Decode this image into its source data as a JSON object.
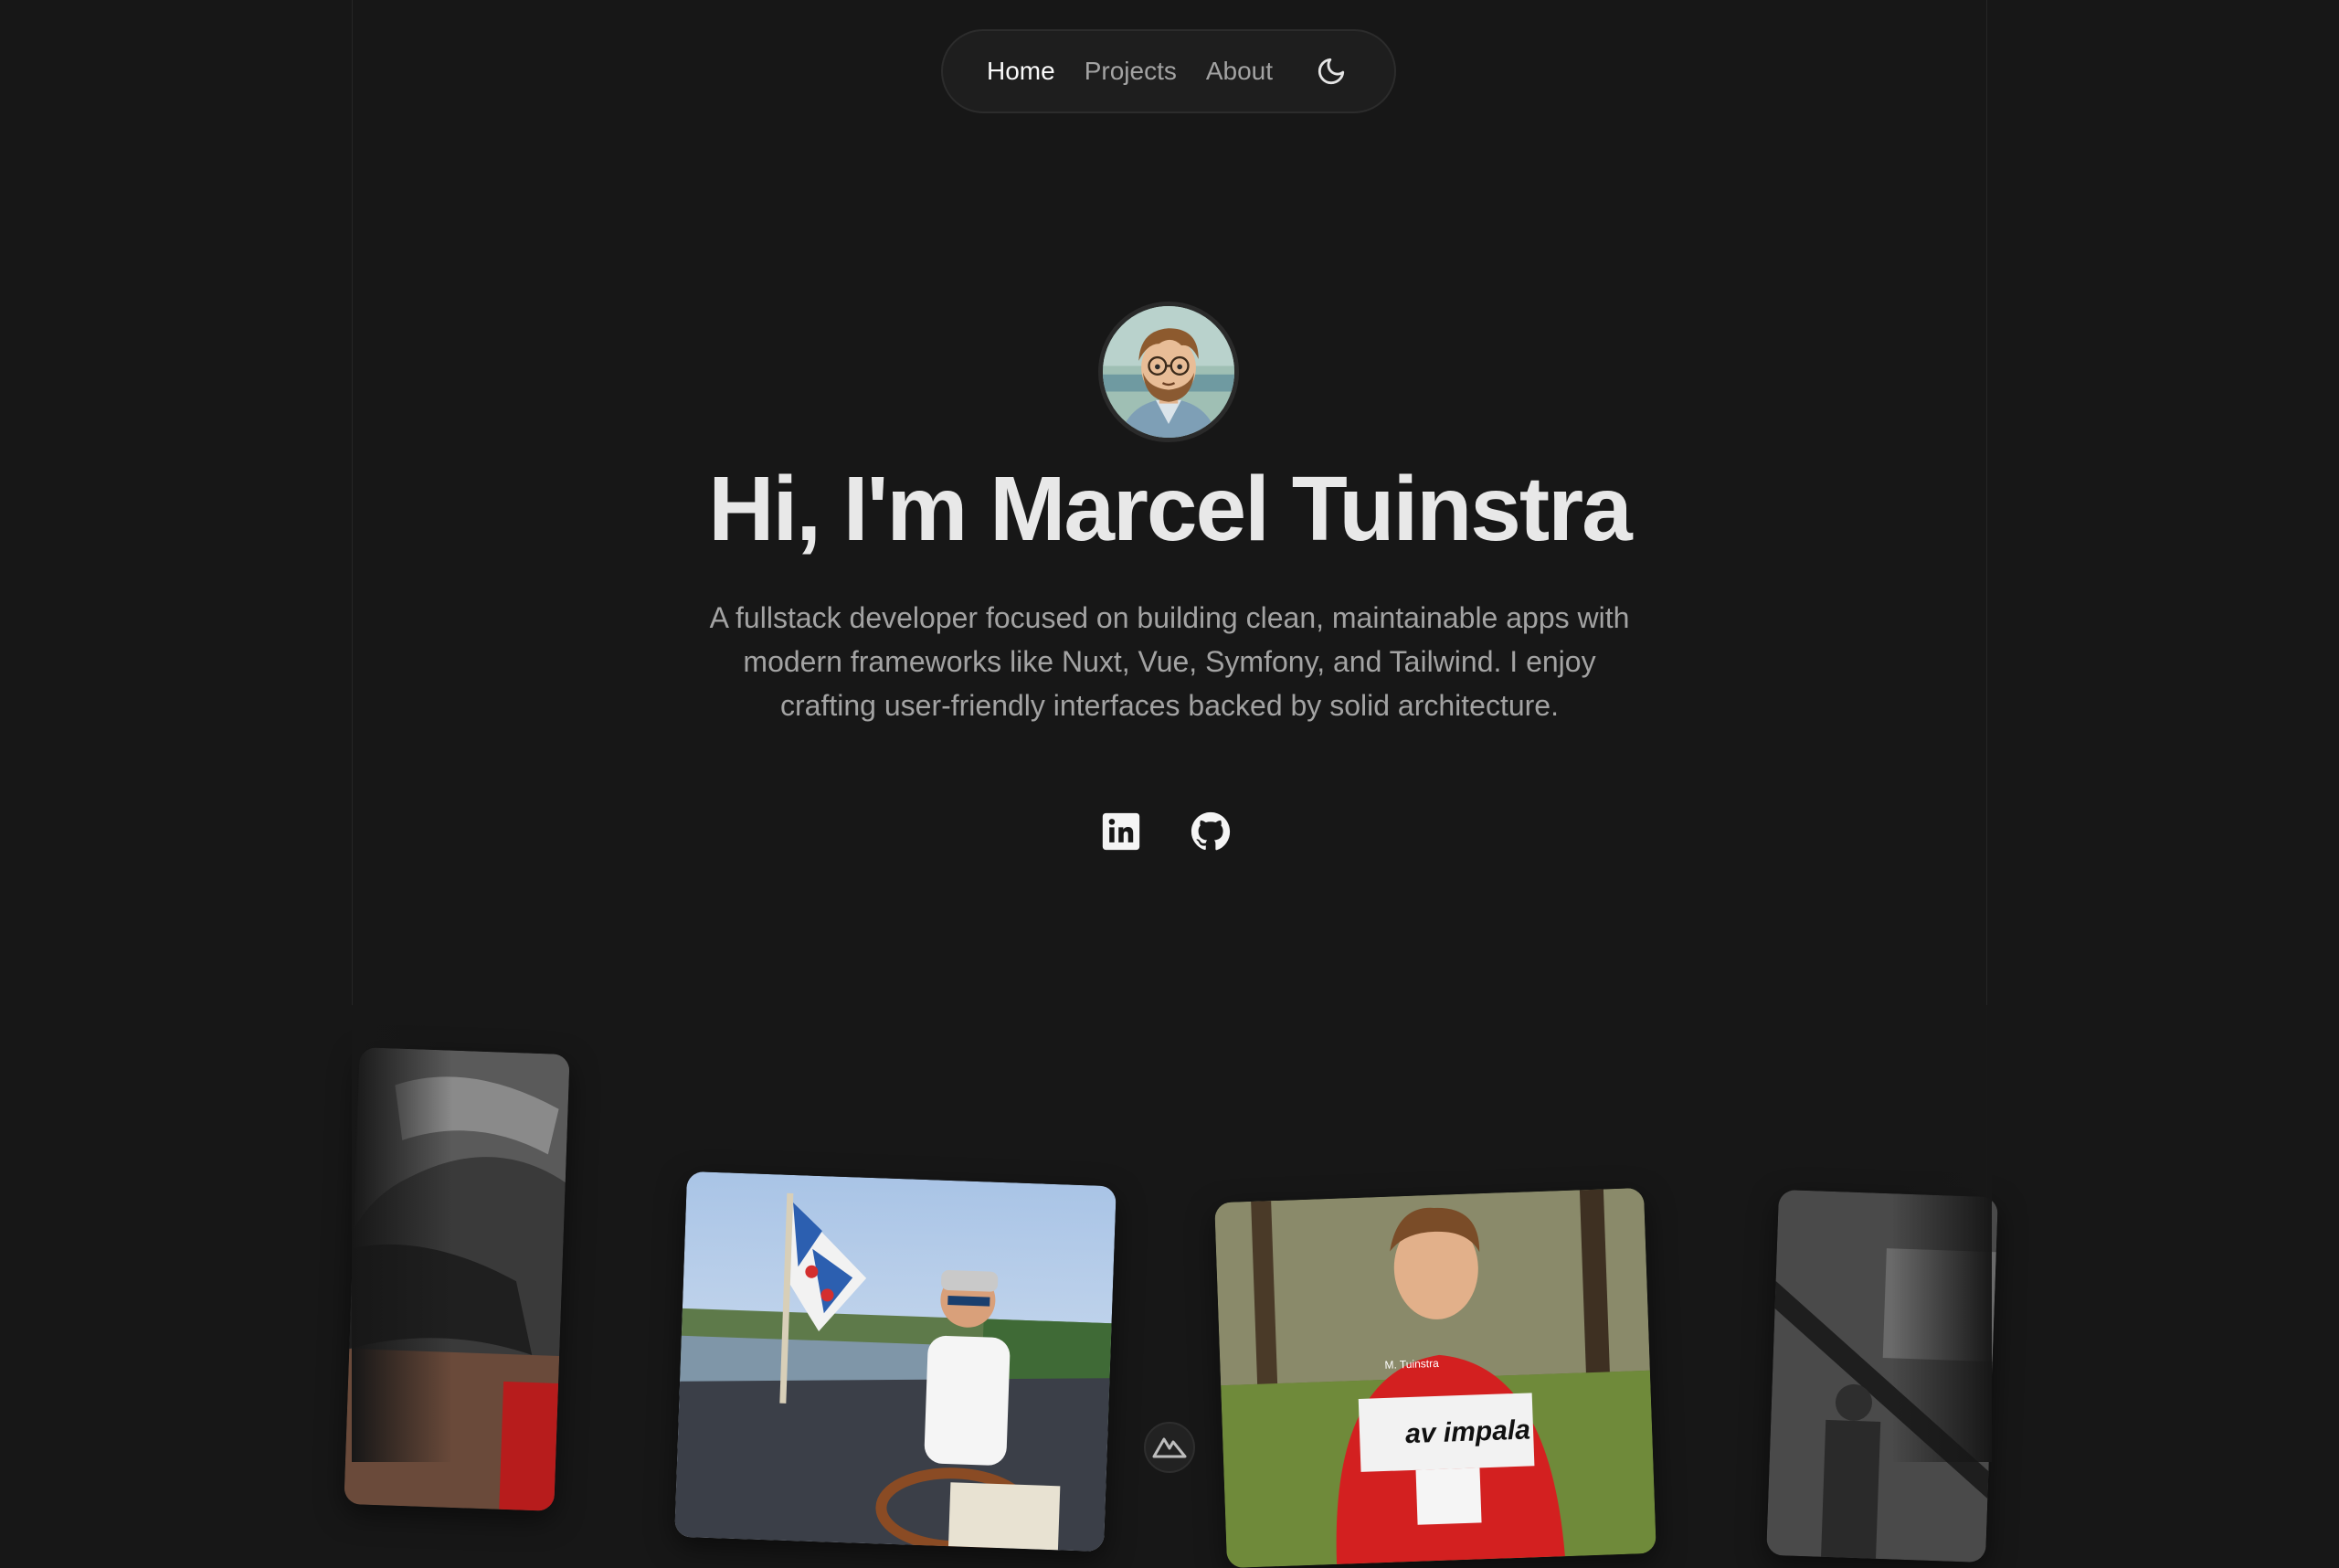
{
  "nav": {
    "items": [
      {
        "label": "Home",
        "active": true
      },
      {
        "label": "Projects",
        "active": false
      },
      {
        "label": "About",
        "active": false
      }
    ],
    "theme_toggle_icon": "moon-icon"
  },
  "hero": {
    "avatar_icon": "avatar-illustration",
    "title": "Hi, I'm Marcel Tuinstra",
    "subtitle": "A fullstack developer focused on building clean, maintainable apps with modern frameworks like Nuxt, Vue, Symfony, and Tailwind. I enjoy crafting user-friendly interfaces backed by solid architecture."
  },
  "socials": [
    {
      "icon": "linkedin-icon"
    },
    {
      "icon": "github-icon"
    }
  ],
  "gallery": {
    "runner_shirt": {
      "name": "M. Tuinstra",
      "club": "av impala"
    },
    "badge_icon": "nuxt-logo-icon"
  },
  "colors": {
    "background": "#171717",
    "text_primary": "#e8e8e8",
    "text_secondary": "#a3a3a3",
    "nav_bg": "#1e1e1e"
  }
}
